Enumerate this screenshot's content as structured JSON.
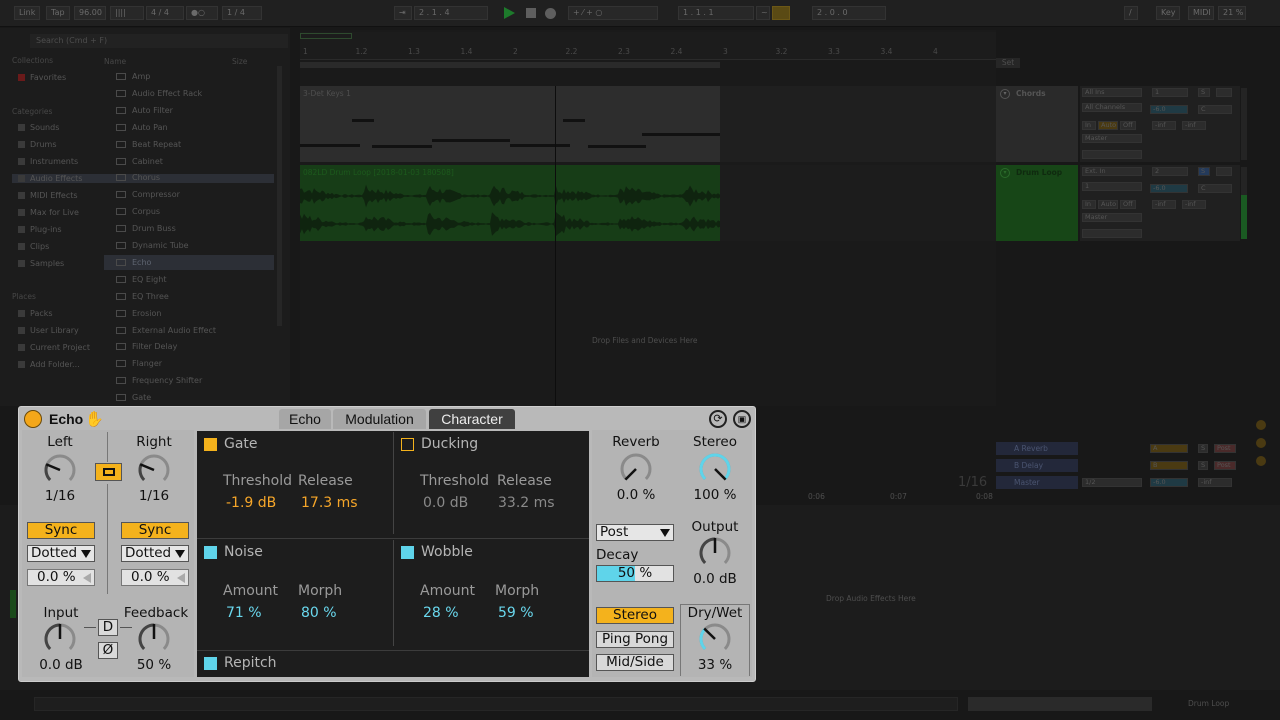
{
  "topbar": {
    "link": "Link",
    "tap": "Tap",
    "tempo": "96.00",
    "meter_icon": "metronome-icon",
    "signature": "4 / 4",
    "quantize": "1 / 4",
    "position": "2 . 1 . 4",
    "loop_start": "1 . 1 . 1",
    "loop_length": "2 . 0 . 0",
    "key": "Key",
    "midi": "MIDI",
    "cpu": "21 %"
  },
  "browser": {
    "search_placeholder": "Search (Cmd + F)",
    "collections_header": "Collections",
    "favorites": "Favorites",
    "categories_header": "Categories",
    "categories": [
      "Sounds",
      "Drums",
      "Instruments",
      "Audio Effects",
      "MIDI Effects",
      "Max for Live",
      "Plug-ins",
      "Clips",
      "Samples"
    ],
    "places_header": "Places",
    "places": [
      "Packs",
      "User Library",
      "Current Project",
      "Add Folder..."
    ],
    "col_name": "Name",
    "col_size": "Size",
    "items": [
      "Amp",
      "Audio Effect Rack",
      "Auto Filter",
      "Auto Pan",
      "Beat Repeat",
      "Cabinet",
      "Chorus",
      "Compressor",
      "Corpus",
      "Drum Buss",
      "Dynamic Tube",
      "Echo",
      "EQ Eight",
      "EQ Three",
      "Erosion",
      "External Audio Effect",
      "Filter Delay",
      "Flanger",
      "Frequency Shifter",
      "Gate"
    ]
  },
  "arrangement": {
    "ruler": [
      "1",
      "1.2",
      "1.3",
      "1.4",
      "2",
      "2.2",
      "2.3",
      "2.4",
      "3",
      "3.2",
      "3.3",
      "3.4",
      "4"
    ],
    "set_label": "Set",
    "clip1": "3-Det Keys 1",
    "clip2": "082LD Drum Loop [2018-01-03 180508]",
    "drop_text": "Drop Files and Devices Here",
    "grid": "1/16",
    "time_marks": [
      "0:06",
      "0:07",
      "0:08"
    ]
  },
  "mixer": {
    "track1": "Chords",
    "track2": "Drum Loop",
    "track1_in": "All Ins",
    "track1_ch": "All Channels",
    "track2_in": "Ext. In",
    "track2_ch": "1",
    "monitor": [
      "In",
      "Auto",
      "Off"
    ],
    "out": "Master",
    "t1_num": "1",
    "t2_num": "2",
    "vol": "-6.0",
    "center": "C",
    "inf": "-inf",
    "solo": "S",
    "ret_a": "A Reverb",
    "ret_b": "B Delay",
    "master": "Master",
    "a": "A",
    "b": "B",
    "post": "Post",
    "master_div": "1/2"
  },
  "detail": {
    "drop_effects": "Drop Audio Effects Here",
    "status_track": "Drum Loop"
  },
  "echo": {
    "title": "Echo",
    "tabs": [
      "Echo",
      "Modulation",
      "Character"
    ],
    "left_label": "Left",
    "right_label": "Right",
    "left_value": "1/16",
    "right_value": "1/16",
    "left_knob_pct": 0.25,
    "right_knob_pct": 0.25,
    "sync": "Sync",
    "dotted": "Dotted",
    "offset": "0.0 %",
    "input_label": "Input",
    "input_value": "0.0 dB",
    "input_knob_pct": 0.5,
    "feedback_label": "Feedback",
    "feedback_value": "50 %",
    "feedback_knob_pct": 0.5,
    "d_button": "D",
    "phase_button": "Ø",
    "gate": {
      "label": "Gate",
      "threshold_label": "Threshold",
      "release_label": "Release",
      "threshold": "-1.9 dB",
      "release": "17.3 ms"
    },
    "ducking": {
      "label": "Ducking",
      "threshold_label": "Threshold",
      "release_label": "Release",
      "threshold": "0.0 dB",
      "release": "33.2 ms"
    },
    "noise": {
      "label": "Noise",
      "amount_label": "Amount",
      "morph_label": "Morph",
      "amount": "71 %",
      "morph": "80 %"
    },
    "wobble": {
      "label": "Wobble",
      "amount_label": "Amount",
      "morph_label": "Morph",
      "amount": "28 %",
      "morph": "59 %"
    },
    "repitch": "Repitch",
    "reverb_label": "Reverb",
    "reverb_value": "0.0 %",
    "reverb_knob_pct": 0.0,
    "stereo_label": "Stereo",
    "stereo_value": "100 %",
    "stereo_knob_pct": 1.0,
    "post": "Post",
    "decay_label": "Decay",
    "decay_value": "50 %",
    "decay_pct": 0.5,
    "output_label": "Output",
    "output_value": "0.0 dB",
    "output_knob_pct": 0.5,
    "mode_stereo": "Stereo",
    "mode_pingpong": "Ping Pong",
    "mode_midside": "Mid/Side",
    "drywet_label": "Dry/Wet",
    "drywet_value": "33 %",
    "drywet_knob_pct": 0.33,
    "colors": {
      "orange": "#f4b21c",
      "blue": "#5fd4ea",
      "orange_text": "#f6a629",
      "blue_text": "#6ad8ee"
    }
  }
}
